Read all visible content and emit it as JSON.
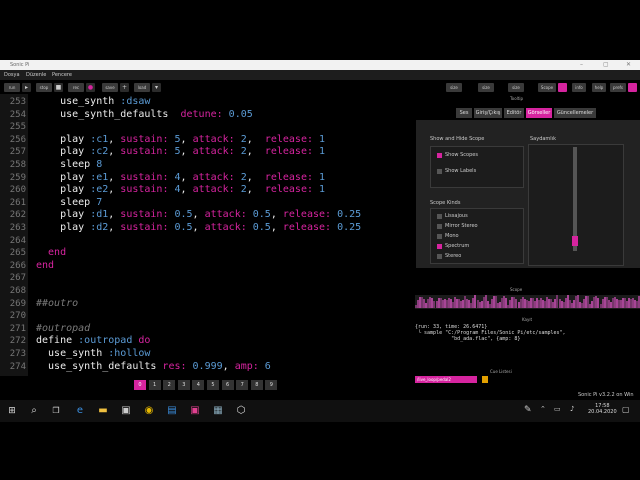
{
  "window": {
    "title": "Sonic Pi",
    "controls": [
      "–",
      "▢",
      "✕"
    ]
  },
  "menu": [
    "Dosya",
    "Düzenle",
    "Pencere"
  ],
  "toolbar": {
    "buttons": [
      "run",
      "stop",
      "rec",
      "save",
      "load"
    ],
    "right_buttons": [
      "size",
      "size",
      "size",
      "Scope",
      "info",
      "help",
      "prefs"
    ]
  },
  "editor": {
    "lines": [
      {
        "n": "253",
        "indent": 6,
        "parts": [
          [
            "w",
            "use_synth "
          ],
          [
            "sym",
            ":dsaw"
          ]
        ]
      },
      {
        "n": "254",
        "indent": 6,
        "parts": [
          [
            "w",
            "use_synth_defaults  "
          ],
          [
            "key",
            "detune: "
          ],
          [
            "num",
            "0.05"
          ]
        ]
      },
      {
        "n": "255",
        "indent": 6,
        "parts": []
      },
      {
        "n": "256",
        "indent": 6,
        "parts": [
          [
            "w",
            "play "
          ],
          [
            "sym",
            ":c1"
          ],
          [
            "w",
            ", "
          ],
          [
            "key",
            "sustain: "
          ],
          [
            "num",
            "5"
          ],
          [
            "w",
            ", "
          ],
          [
            "key",
            "attack: "
          ],
          [
            "num",
            "2"
          ],
          [
            "w",
            ",  "
          ],
          [
            "key",
            "release: "
          ],
          [
            "num",
            "1"
          ]
        ]
      },
      {
        "n": "257",
        "indent": 6,
        "parts": [
          [
            "w",
            "play "
          ],
          [
            "sym",
            ":c2"
          ],
          [
            "w",
            ", "
          ],
          [
            "key",
            "sustain: "
          ],
          [
            "num",
            "5"
          ],
          [
            "w",
            ", "
          ],
          [
            "key",
            "attack: "
          ],
          [
            "num",
            "2"
          ],
          [
            "w",
            ",  "
          ],
          [
            "key",
            "release: "
          ],
          [
            "num",
            "1"
          ]
        ]
      },
      {
        "n": "258",
        "indent": 6,
        "parts": [
          [
            "w",
            "sleep "
          ],
          [
            "num",
            "8"
          ]
        ]
      },
      {
        "n": "259",
        "indent": 6,
        "parts": [
          [
            "w",
            "play "
          ],
          [
            "sym",
            ":e1"
          ],
          [
            "w",
            ", "
          ],
          [
            "key",
            "sustain: "
          ],
          [
            "num",
            "4"
          ],
          [
            "w",
            ", "
          ],
          [
            "key",
            "attack: "
          ],
          [
            "num",
            "2"
          ],
          [
            "w",
            ",  "
          ],
          [
            "key",
            "release: "
          ],
          [
            "num",
            "1"
          ]
        ]
      },
      {
        "n": "260",
        "indent": 6,
        "parts": [
          [
            "w",
            "play "
          ],
          [
            "sym",
            ":e2"
          ],
          [
            "w",
            ", "
          ],
          [
            "key",
            "sustain: "
          ],
          [
            "num",
            "4"
          ],
          [
            "w",
            ", "
          ],
          [
            "key",
            "attack: "
          ],
          [
            "num",
            "2"
          ],
          [
            "w",
            ",  "
          ],
          [
            "key",
            "release: "
          ],
          [
            "num",
            "1"
          ]
        ]
      },
      {
        "n": "261",
        "indent": 6,
        "parts": [
          [
            "w",
            "sleep "
          ],
          [
            "num",
            "7"
          ]
        ]
      },
      {
        "n": "262",
        "indent": 6,
        "parts": [
          [
            "w",
            "play "
          ],
          [
            "sym",
            ":d1"
          ],
          [
            "w",
            ", "
          ],
          [
            "key",
            "sustain: "
          ],
          [
            "num",
            "0.5"
          ],
          [
            "w",
            ", "
          ],
          [
            "key",
            "attack: "
          ],
          [
            "num",
            "0.5"
          ],
          [
            "w",
            ", "
          ],
          [
            "key",
            "release: "
          ],
          [
            "num",
            "0.25"
          ]
        ]
      },
      {
        "n": "263",
        "indent": 6,
        "parts": [
          [
            "w",
            "play "
          ],
          [
            "sym",
            ":d2"
          ],
          [
            "w",
            ", "
          ],
          [
            "key",
            "sustain: "
          ],
          [
            "num",
            "0.5"
          ],
          [
            "w",
            ", "
          ],
          [
            "key",
            "attack: "
          ],
          [
            "num",
            "0.5"
          ],
          [
            "w",
            ", "
          ],
          [
            "key",
            "release: "
          ],
          [
            "num",
            "0.25"
          ]
        ]
      },
      {
        "n": "264",
        "indent": 6,
        "parts": []
      },
      {
        "n": "265",
        "indent": 4,
        "parts": [
          [
            "key",
            "end"
          ]
        ]
      },
      {
        "n": "266",
        "indent": 2,
        "parts": [
          [
            "key",
            "end"
          ]
        ]
      },
      {
        "n": "267",
        "indent": 2,
        "parts": []
      },
      {
        "n": "268",
        "indent": 2,
        "parts": []
      },
      {
        "n": "269",
        "indent": 2,
        "parts": [
          [
            "cmt",
            "##outro"
          ]
        ]
      },
      {
        "n": "270",
        "indent": 2,
        "parts": []
      },
      {
        "n": "271",
        "indent": 2,
        "parts": [
          [
            "cmt",
            "#outropad"
          ]
        ]
      },
      {
        "n": "272",
        "indent": 2,
        "parts": [
          [
            "w",
            "define "
          ],
          [
            "sym",
            ":outropad "
          ],
          [
            "key",
            "do"
          ]
        ]
      },
      {
        "n": "273",
        "indent": 4,
        "parts": [
          [
            "w",
            "use_synth "
          ],
          [
            "sym",
            ":hollow"
          ]
        ]
      },
      {
        "n": "274",
        "indent": 4,
        "parts": [
          [
            "w",
            "use_synth_defaults "
          ],
          [
            "key",
            "res: "
          ],
          [
            "num",
            "0.999"
          ],
          [
            "w",
            ", "
          ],
          [
            "key",
            "amp: "
          ],
          [
            "num",
            "6"
          ]
        ]
      }
    ]
  },
  "buffer_tabs": [
    "0",
    "1",
    "2",
    "3",
    "4",
    "5",
    "6",
    "7",
    "8",
    "9"
  ],
  "right_panel": {
    "tooltip": "Tooltip",
    "pref_tabs": [
      "Ses",
      "Giriş/Çıkış",
      "Editör",
      "Görseller",
      "Güncellemeler"
    ],
    "show_hide_scope": {
      "title": "Show and Hide Scope",
      "items": [
        {
          "label": "Show Scopes",
          "checked": true
        },
        {
          "label": "Show Labels",
          "checked": false
        }
      ]
    },
    "transparency": {
      "title": "Saydamlık",
      "level": 0.05
    },
    "scope_kinds": {
      "title": "Scope Kinds",
      "items": [
        {
          "label": "Lissajous",
          "checked": false
        },
        {
          "label": "Mirror Stereo",
          "checked": false
        },
        {
          "label": "Mono",
          "checked": false
        },
        {
          "label": "Spectrum",
          "checked": true
        },
        {
          "label": "Stereo",
          "checked": false
        }
      ]
    },
    "scope_label": "Scope",
    "log_label": "Kayıt",
    "log_text": "{run: 33, time: 26.6471}\n └ sample \"C:/Program Files/Sonic Pi/etc/samples\",\n            \"bd_ada.flac\", {amp: 8}",
    "cue_label": "Cue Listesi",
    "cue_entry": "/live_loop/pedal2",
    "footer": "Sonic Pi v3.2.2 on Win"
  },
  "taskbar": {
    "clock_time": "17:58",
    "clock_date": "20.04.2020",
    "icons": [
      "windows-icon",
      "search-icon",
      "task-view-icon",
      "edge-icon",
      "explorer-icon",
      "store-icon",
      "chrome-icon",
      "outlook-icon",
      "app-icon",
      "notepad-icon",
      "sonic-pi-icon"
    ]
  },
  "colors": {
    "accent": "#d6249f",
    "symbol": "#5b9bd5",
    "background": "#000000"
  }
}
